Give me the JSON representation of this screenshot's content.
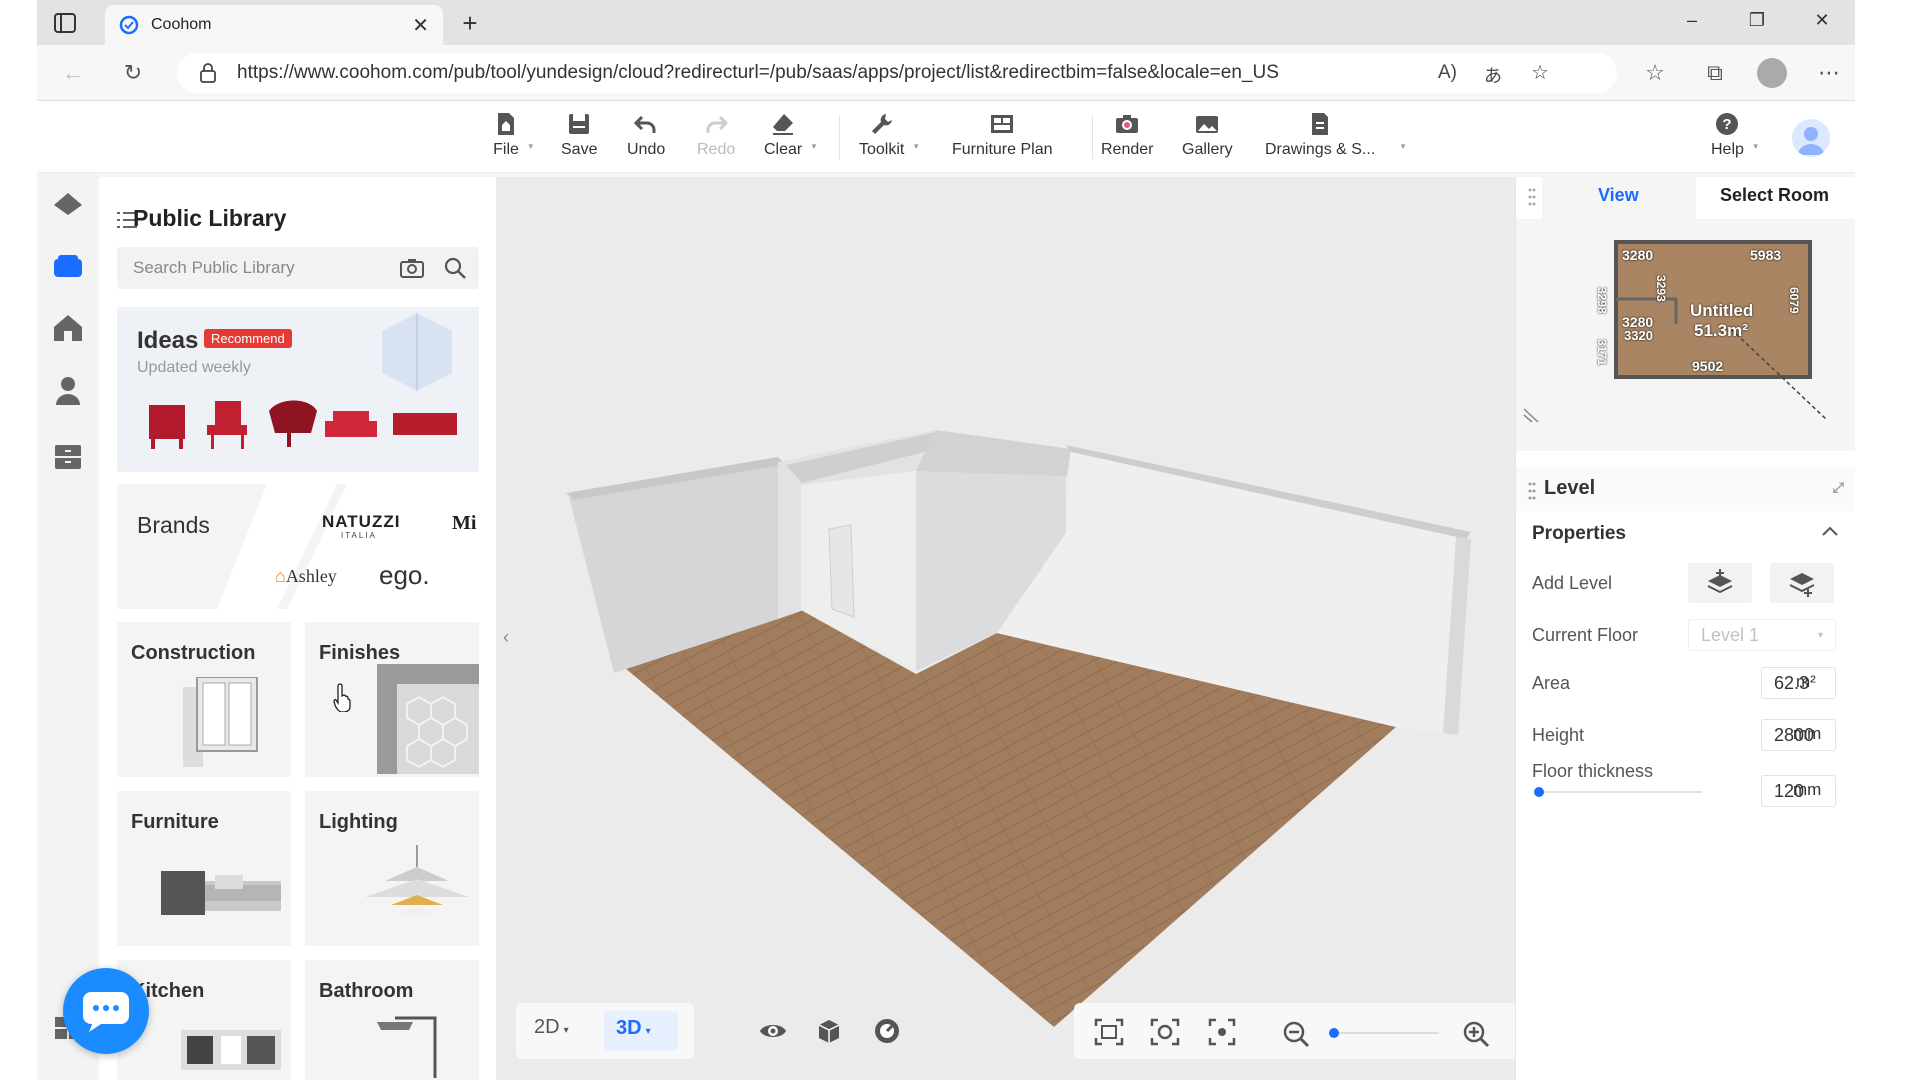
{
  "browser": {
    "tab_title": "Coohom",
    "tab_close": "✕",
    "new_tab": "+",
    "url": "https://www.coohom.com/pub/tool/yundesign/cloud?redirecturl=/pub/saas/apps/project/list&redirectbim=false&locale=en_US",
    "window_controls": [
      "–",
      "❐",
      "✕"
    ]
  },
  "toolbar": {
    "file": "File",
    "save": "Save",
    "undo": "Undo",
    "redo": "Redo",
    "clear": "Clear",
    "toolkit": "Toolkit",
    "furniture_plan": "Furniture Plan",
    "render": "Render",
    "gallery": "Gallery",
    "drawings": "Drawings & S...",
    "help": "Help"
  },
  "library": {
    "title": "Public Library",
    "search_placeholder": "Search Public Library",
    "ideas": {
      "title": "Ideas",
      "badge": "Recommend",
      "subtitle": "Updated weekly"
    },
    "brands": {
      "title": "Brands",
      "logos": [
        "NATUZZI",
        "ITALIA",
        "Mi",
        "Ashley",
        "ego."
      ]
    },
    "categories": [
      "Construction",
      "Finishes",
      "Furniture",
      "Lighting",
      "Kitchen",
      "Bathroom"
    ]
  },
  "viewport": {
    "collapse": "‹"
  },
  "right_panel": {
    "tabs": [
      "View",
      "Select Room"
    ],
    "minimap": {
      "dims": [
        "3280",
        "5983",
        "3298",
        "3280",
        "3320",
        "6079",
        "3171",
        "9502",
        "3293"
      ],
      "room_name": "Untitled",
      "room_area": "51.3m²"
    },
    "level_title": "Level",
    "properties_title": "Properties",
    "add_level": "Add Level",
    "current_floor_label": "Current Floor",
    "current_floor_value": "Level 1",
    "area_label": "Area",
    "area_value": "62.3",
    "area_unit": "m²",
    "height_label": "Height",
    "height_value": "2800",
    "height_unit": "mm",
    "floor_thickness_label": "Floor thickness",
    "floor_thickness_value": "120",
    "floor_thickness_unit": "mm",
    "floor_thickness_slider_fraction": 0.0
  },
  "bottom": {
    "mode_2d": "2D",
    "mode_3d": "3D",
    "zoom_fraction": 0.0
  },
  "colors": {
    "accent": "#1a6dff",
    "badge_red": "#e53935",
    "floor_wood": "#a27d5d",
    "chat_blue": "#1a8cff"
  }
}
